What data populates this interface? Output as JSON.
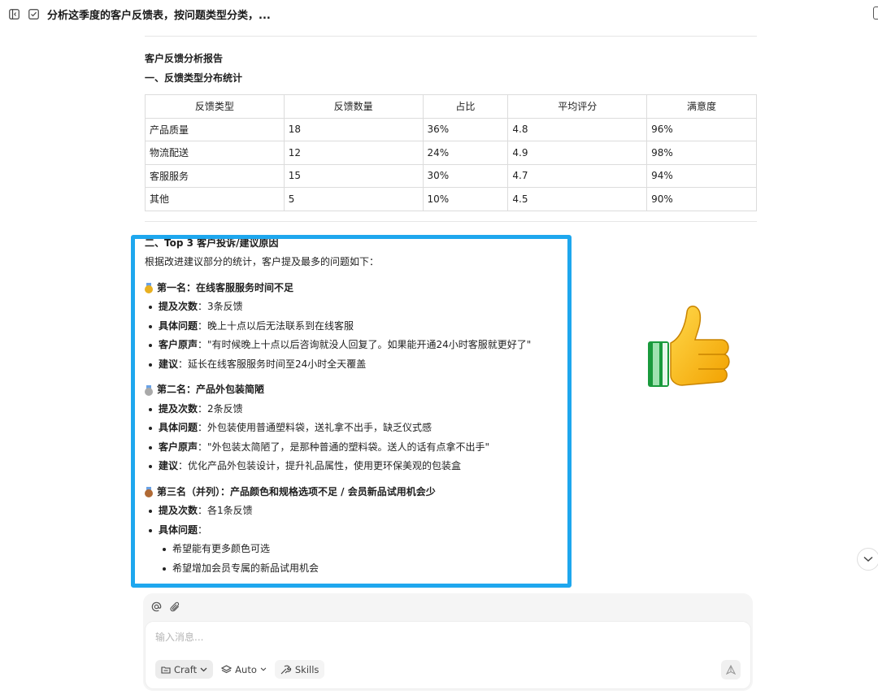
{
  "topbar": {
    "title": "分析这季度的客户反馈表，按问题类型分类，..."
  },
  "report": {
    "title": "客户反馈分析报告",
    "section1_title": "一、反馈类型分布统计",
    "table": {
      "headers": [
        "反馈类型",
        "反馈数量",
        "占比",
        "平均评分",
        "满意度"
      ],
      "rows": [
        [
          "产品质量",
          "18",
          "36%",
          "4.8",
          "96%"
        ],
        [
          "物流配送",
          "12",
          "24%",
          "4.9",
          "98%"
        ],
        [
          "客服服务",
          "15",
          "30%",
          "4.7",
          "94%"
        ],
        [
          "其他",
          "5",
          "10%",
          "4.5",
          "90%"
        ]
      ]
    },
    "section2_title": "二、Top 3 客户投诉/建议原因",
    "section2_intro": "根据改进建议部分的统计，客户提及最多的问题如下：",
    "ranks": [
      {
        "heading": "第一名：在线客服服务时间不足",
        "medal_color": "#e8b021",
        "items": [
          {
            "label": "提及次数",
            "text": "：3条反馈"
          },
          {
            "label": "具体问题",
            "text": "：晚上十点以后无法联系到在线客服"
          },
          {
            "label": "客户原声",
            "text": "：\"有时候晚上十点以后咨询就没人回复了。如果能开通24小时客服就更好了\""
          },
          {
            "label": "建议",
            "text": "：延长在线客服服务时间至24小时全天覆盖"
          }
        ]
      },
      {
        "heading": "第二名：产品外包装简陋",
        "medal_color": "#a9a9a9",
        "items": [
          {
            "label": "提及次数",
            "text": "：2条反馈"
          },
          {
            "label": "具体问题",
            "text": "：外包装使用普通塑料袋，送礼拿不出手，缺乏仪式感"
          },
          {
            "label": "客户原声",
            "text": "：\"外包装太简陋了，是那种普通的塑料袋。送人的话有点拿不出手\""
          },
          {
            "label": "建议",
            "text": "：优化产品外包装设计，提升礼品属性，使用更环保美观的包装盒"
          }
        ]
      },
      {
        "heading": "第三名（并列）：产品颜色和规格选项不足 / 会员新品试用机会少",
        "medal_color": "#b06a35",
        "items": [
          {
            "label": "提及次数",
            "text": "：各1条反馈"
          },
          {
            "label": "具体问题",
            "text": "："
          }
        ],
        "subitems": [
          "希望能有更多颜色可选",
          "希望增加会员专属的新品试用机会"
        ]
      }
    ]
  },
  "composer": {
    "placeholder": "输入消息...",
    "craft_label": "Craft",
    "auto_label": "Auto",
    "skills_label": "Skills"
  },
  "colors": {
    "highlight": "#1ea7ee",
    "thumb": "#f7b500"
  }
}
